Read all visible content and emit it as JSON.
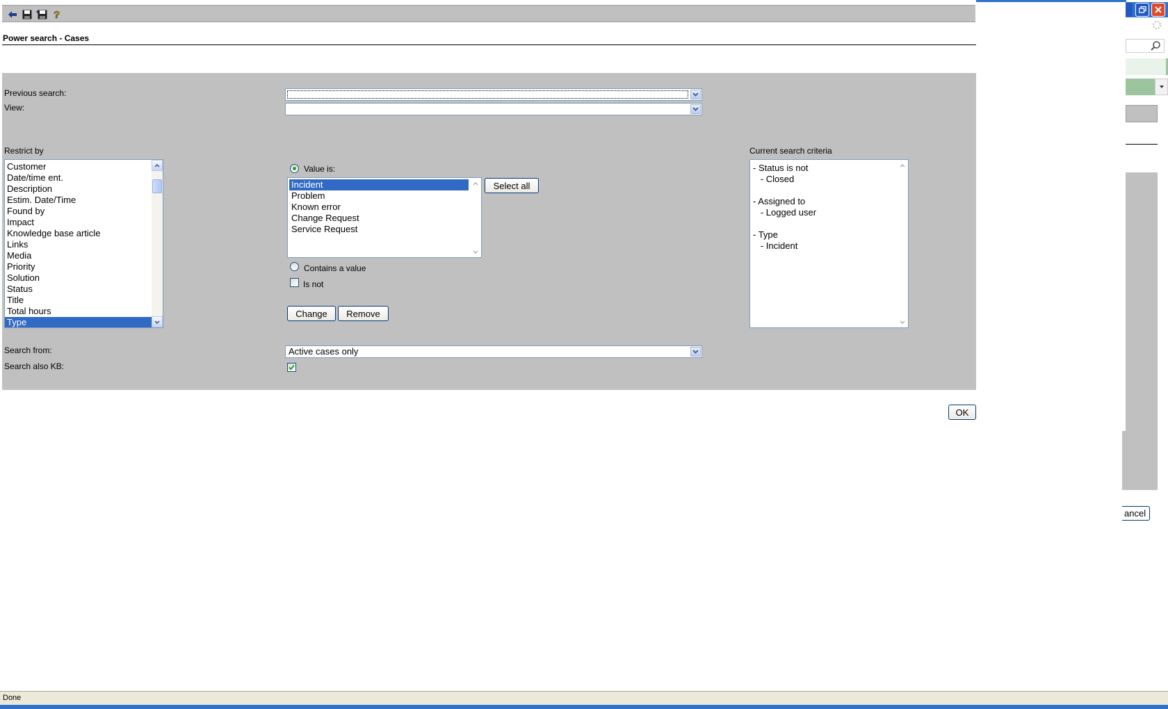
{
  "toolbar": {
    "icons": [
      "back-arrow-icon",
      "save-icon",
      "save-as-icon",
      "help-icon"
    ]
  },
  "page_title": "Power search - Cases",
  "form": {
    "previous_search_label": "Previous search:",
    "previous_search_value": "",
    "view_label": "View:",
    "view_value": "",
    "restrict_by_label": "Restrict by",
    "restrict_items": [
      "Customer",
      "Date/time ent.",
      "Description",
      "Estim. Date/Time",
      "Found by",
      "Impact",
      "Knowledge base article",
      "Links",
      "Media",
      "Priority",
      "Solution",
      "Status",
      "Title",
      "Total hours",
      "Type"
    ],
    "restrict_selected": "Type",
    "value_is_label": "Value is:",
    "value_is_checked": true,
    "value_items": [
      "Incident",
      "Problem",
      "Known error",
      "Change Request",
      "Service Request"
    ],
    "value_selected": "Incident",
    "select_all_label": "Select all",
    "contains_value_label": "Contains a value",
    "is_not_label": "Is not",
    "is_not_checked": false,
    "change_label": "Change",
    "remove_label": "Remove",
    "current_criteria_label": "Current search criteria",
    "criteria_lines": [
      "- Status is not",
      "   - Closed",
      "",
      "- Assigned to",
      "   - Logged user",
      "",
      "- Type",
      "   - Incident"
    ],
    "search_from_label": "Search from:",
    "search_from_value": "Active cases only",
    "search_kb_label": "Search also KB:",
    "search_kb_checked": true
  },
  "ok_label": "OK",
  "background_window": {
    "cancel_label_partial": "ancel"
  },
  "status_bar": {
    "text": "Done"
  },
  "colors": {
    "panel": "#c0c0c0",
    "selection": "#316ac5",
    "border": "#7f9db9"
  }
}
